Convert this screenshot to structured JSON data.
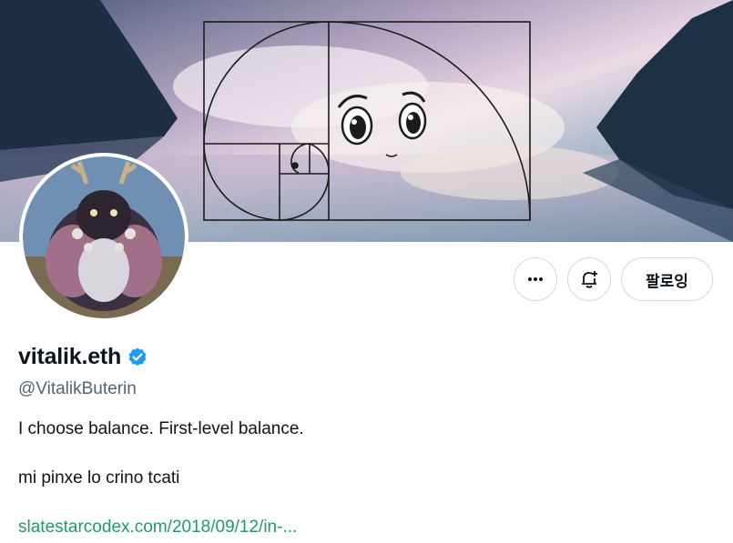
{
  "profile": {
    "display_name": "vitalik.eth",
    "handle": "@VitalikButerin",
    "verified": true,
    "bio_line1": "I choose balance. First-level balance.",
    "bio_line2": "mi pinxe lo crino tcati",
    "website": "slatestarcodex.com/2018/09/12/in-..."
  },
  "actions": {
    "more_icon": "more-horizontal-icon",
    "notify_icon": "bell-plus-icon",
    "follow_label": "팔로잉"
  },
  "colors": {
    "accent_link": "#1d9b6f",
    "verified_badge": "#1d9bf0",
    "secondary_text": "#536471",
    "border": "#cfd9de"
  },
  "banner": {
    "description_icon": "golden-spiral-banner"
  }
}
